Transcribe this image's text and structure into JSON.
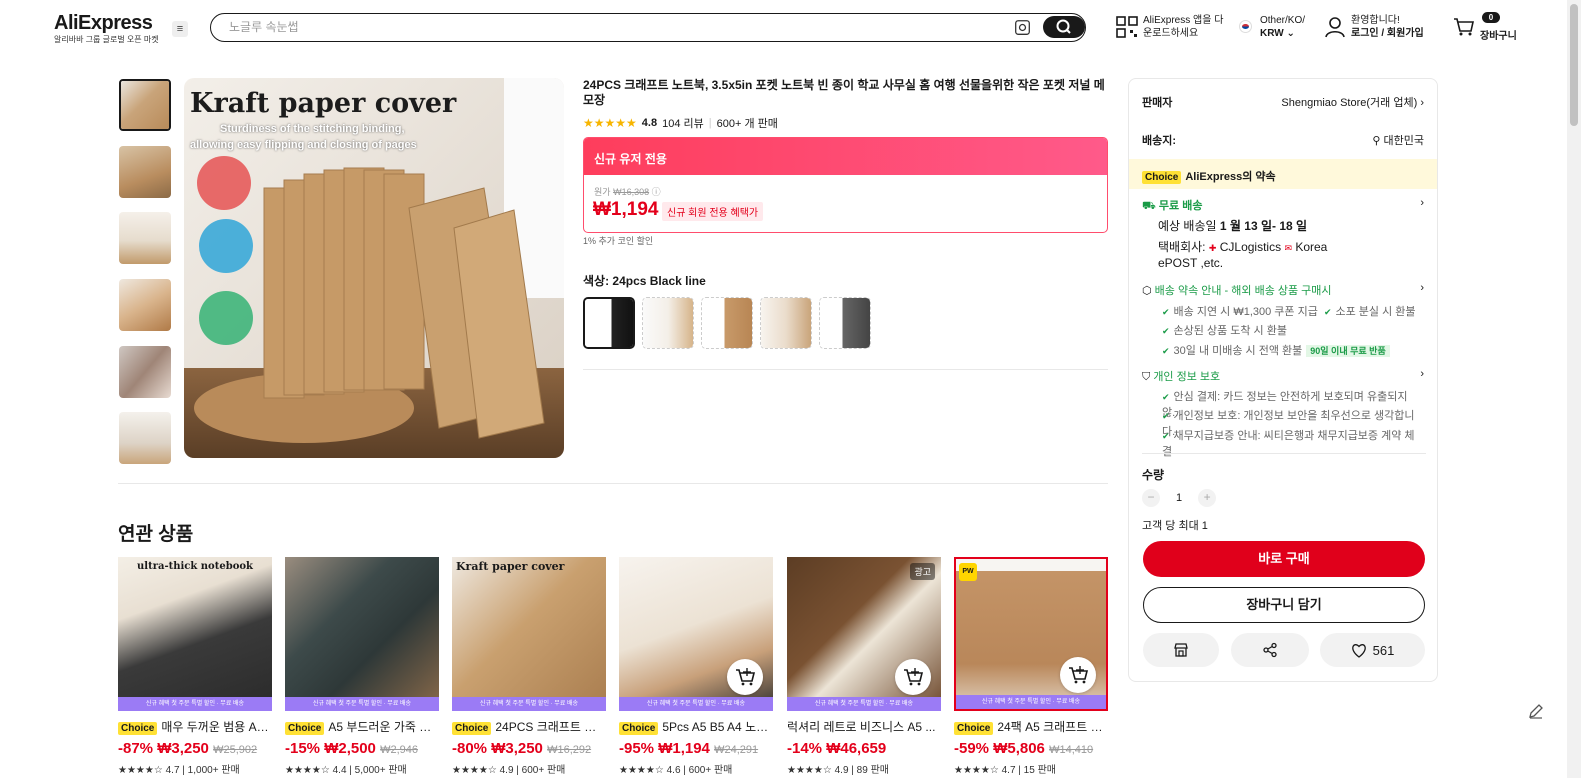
{
  "header": {
    "logo": "AliExpress",
    "logo_sub": "알리바바 그룹 글로벌 오픈 마켓",
    "search_placeholder": "노글루 속눈썹",
    "app_line1": "AliExpress 앱을 다",
    "app_line2": "운로드하세요",
    "region_line1": "Other/KO/",
    "region_line2": "KRW",
    "account_line1": "환영합니다!",
    "account_line2": "로그인 / 회원가입",
    "cart_count": "0",
    "cart_label": "장바구니"
  },
  "product": {
    "title": "24PCS 크래프트 노트북, 3.5x5in 포켓 노트북 빈 종이 학교 사무실 홈 여행 선물을위한 작은 포켓 저널 메모장",
    "rating": "4.8",
    "reviews": "104 리뷰",
    "sold": "600+ 개 판매",
    "image_heading": "Kraft paper cover",
    "image_subheading_1": "Sturdiness of the stitching binding,",
    "image_subheading_2": "allowing easy flipping and closing of pages",
    "promo_header": "신규 유저 전용",
    "original_label": "원가",
    "original_price": "₩16,308",
    "price": "₩1,194",
    "new_member_tag": "신규 회원 전용 혜택가",
    "coin_discount": "1% 추가 코인 할인",
    "color_label": "색상: 24pcs Black line"
  },
  "panel": {
    "seller_label": "판매자",
    "seller_name": "Shengmiao Store(거래 업체)",
    "ship_to_label": "배송지:",
    "ship_to": "대한민국",
    "choice_badge": "Choice",
    "promise_title": "AliExpress의 약속",
    "free_shipping": "무료 배송",
    "eta_prefix": "예상 배송일",
    "eta": "1 월 13 일- 18 일",
    "courier_label": "택배회사:",
    "courier_1": "CJLogistics",
    "courier_2": "Korea",
    "courier_3": "ePOST ,etc.",
    "promise_guide": "배송 약속 안내 - 해외 배송 상품 구매시",
    "guide_1": "배송 지연 시 ₩1,300 쿠폰 지급",
    "guide_2": "소포 분실 시 환불",
    "guide_3": "손상된 상품 도착 시 환불",
    "guide_4": "30일 내 미배송 시 전액 환불",
    "guide_tag": "90일 이내 무료 반품",
    "privacy_title": "개인 정보 보호",
    "privacy_1": "안심 결제: 카드 정보는 안전하게 보호되며 유출되지 않...",
    "privacy_2": "개인정보 보호: 개인정보 보안을 최우선으로 생각합니다.",
    "privacy_3": "채무지급보증 안내: 씨티은행과 채무지급보증 계약 체결",
    "qty_label": "수량",
    "qty_minus": "−",
    "qty_value": "1",
    "qty_plus": "+",
    "max_per": "고객 당 최대 1",
    "buy_now": "바로 구매",
    "add_cart": "장바구니 담기",
    "wishlist_count": "561"
  },
  "related": {
    "title": "연관 상품",
    "band_text": "신규 혜택 첫 주문 특별 할인 · 무료 배송",
    "ad_label": "광고",
    "items": [
      {
        "choice": "Choice",
        "title": "매우 두꺼운 범용 A5/...",
        "discount": "-87%",
        "price": "₩3,250",
        "orig": "₩25,902",
        "rating": "4.7",
        "sold": "1,000+ 판매",
        "caption": "ultra-thick notebook"
      },
      {
        "choice": "Choice",
        "title": "A5 부드러운 가죽 노트...",
        "discount": "-15%",
        "price": "₩2,500",
        "orig": "₩2,946",
        "rating": "4.4",
        "sold": "5,000+ 판매"
      },
      {
        "choice": "Choice",
        "title": "24PCS 크래프트 노트...",
        "discount": "-80%",
        "price": "₩3,250",
        "orig": "₩16,292",
        "rating": "4.9",
        "sold": "600+ 판매",
        "caption": "Kraft paper cover"
      },
      {
        "choice": "Choice",
        "title": "5Pcs A5 B5 A4 노트...",
        "discount": "-95%",
        "price": "₩1,194",
        "orig": "₩24,291",
        "rating": "4.6",
        "sold": "600+ 판매"
      },
      {
        "choice": "",
        "title": "럭셔리 레트로 비즈니스 A5 ...",
        "discount": "-14%",
        "price": "₩46,659",
        "orig": "",
        "rating": "4.9",
        "sold": "89 판매"
      },
      {
        "choice": "Choice",
        "title": "24팩 A5 크래프트 종...",
        "discount": "-59%",
        "price": "₩5,806",
        "orig": "₩14,410",
        "rating": "4.7",
        "sold": "15 판매"
      }
    ]
  }
}
